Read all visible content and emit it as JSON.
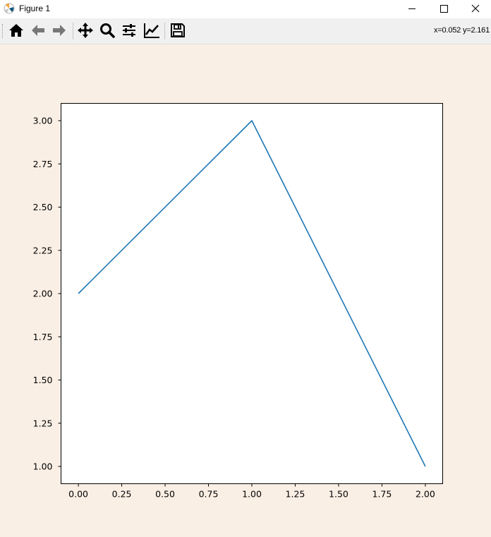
{
  "window": {
    "title": "Figure 1",
    "controls": [
      "minimize",
      "maximize",
      "close"
    ]
  },
  "toolbar": {
    "tools": [
      {
        "name": "home-icon",
        "tooltip": "Reset original view"
      },
      {
        "name": "back-icon",
        "tooltip": "Back to previous view"
      },
      {
        "name": "forward-icon",
        "tooltip": "Forward to next view"
      },
      {
        "name": "pan-icon",
        "tooltip": "Pan axes"
      },
      {
        "name": "zoom-icon",
        "tooltip": "Zoom to rectangle"
      },
      {
        "name": "subplots-icon",
        "tooltip": "Configure subplots"
      },
      {
        "name": "axes-edit-icon",
        "tooltip": "Edit axis, curve and image parameters"
      },
      {
        "name": "save-icon",
        "tooltip": "Save the figure"
      }
    ],
    "coords": "x=0.052 y=2.161"
  },
  "colors": {
    "figure_bg": "#faefe5",
    "axes_bg": "#ffffff",
    "line": "#1f77b4",
    "disabled_icon": "#777777"
  },
  "chart_data": {
    "type": "line",
    "x": [
      0,
      1,
      2
    ],
    "series": [
      {
        "values": [
          2,
          3,
          1
        ],
        "color": "#1f77b4"
      }
    ],
    "xlim": [
      -0.1,
      2.1
    ],
    "ylim": [
      0.9,
      3.1
    ],
    "xticks": [
      "0.00",
      "0.25",
      "0.50",
      "0.75",
      "1.00",
      "1.25",
      "1.50",
      "1.75",
      "2.00"
    ],
    "yticks": [
      "1.00",
      "1.25",
      "1.50",
      "1.75",
      "2.00",
      "2.25",
      "2.50",
      "2.75",
      "3.00"
    ],
    "title": "",
    "xlabel": "",
    "ylabel": "",
    "grid": false,
    "legend": "none"
  }
}
